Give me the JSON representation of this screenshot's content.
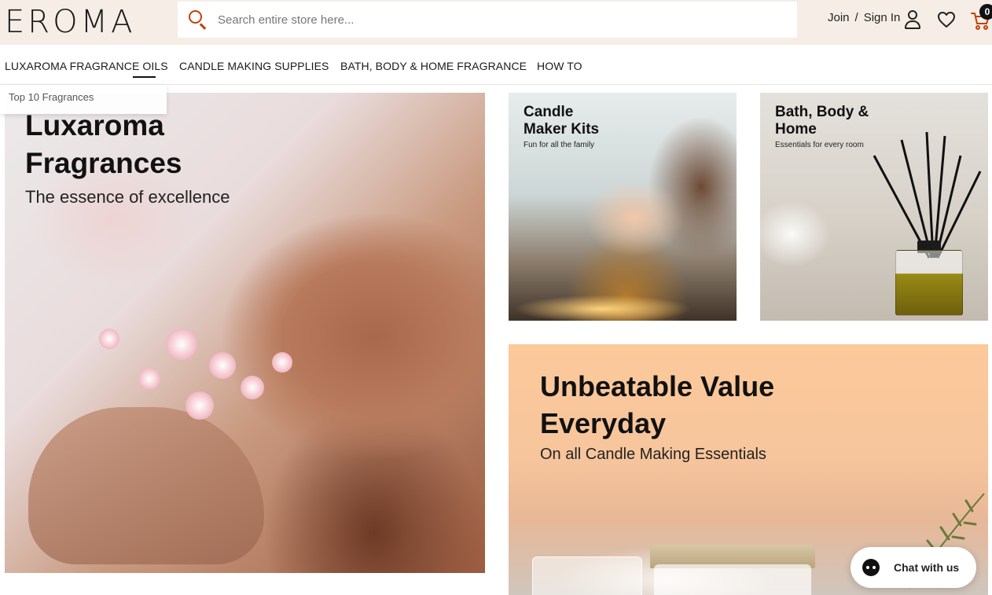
{
  "header": {
    "logo": "EROMA",
    "search_placeholder": "Search entire store here...",
    "join_label": "Join",
    "separator": "/",
    "signin_label": "Sign In",
    "cart_count": "0",
    "accent_color": "#c2410c"
  },
  "nav": {
    "items": [
      {
        "label": "LUXAROMA FRAGRANCE OILS"
      },
      {
        "label": "CANDLE MAKING SUPPLIES"
      },
      {
        "label": "BATH, BODY & HOME FRAGRANCE"
      },
      {
        "label": "HOW TO"
      }
    ],
    "dropdown_item": "Top 10 Fragrances"
  },
  "hero": {
    "main": {
      "title_line1": "Luxaroma",
      "title_line2": "Fragrances",
      "subtitle": "The essence of excellence"
    },
    "kits": {
      "title_line1": "Candle",
      "title_line2": "Maker Kits",
      "subtitle": "Fun for all the family"
    },
    "bath": {
      "title_line1": "Bath, Body &",
      "title_line2": "Home",
      "subtitle": "Essentials for every room"
    },
    "value": {
      "title_line1": "Unbeatable Value",
      "title_line2": "Everyday",
      "subtitle": "On all Candle Making Essentials"
    }
  },
  "chat": {
    "label": "Chat with us"
  }
}
